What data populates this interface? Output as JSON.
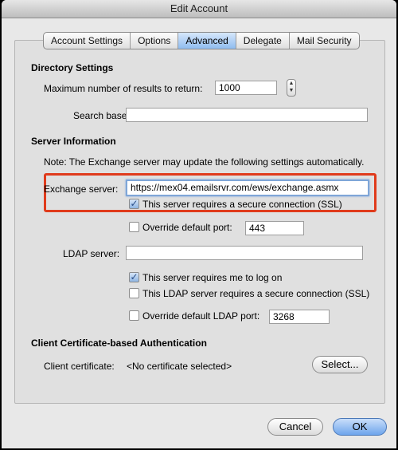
{
  "window": {
    "title": "Edit Account"
  },
  "tabs": [
    {
      "label": "Account Settings"
    },
    {
      "label": "Options"
    },
    {
      "label": "Advanced"
    },
    {
      "label": "Delegate"
    },
    {
      "label": "Mail Security"
    }
  ],
  "directory": {
    "heading": "Directory Settings",
    "max_results_label": "Maximum number of results to return:",
    "max_results_value": "1000",
    "search_base_label": "Search base:",
    "search_base_value": ""
  },
  "server": {
    "heading": "Server Information",
    "note": "Note: The Exchange server may update the following settings automatically.",
    "exchange_label": "Exchange server:",
    "exchange_value": "https://mex04.emailsrvr.com/ews/exchange.asmx",
    "ssl_label": "This server requires a secure connection (SSL)",
    "ssl_checked": true,
    "override_port_label": "Override default port:",
    "override_port_checked": false,
    "port_value": "443",
    "ldap_label": "LDAP server:",
    "ldap_value": "",
    "logon_label": "This server requires me to log on",
    "logon_checked": true,
    "ldap_ssl_label": "This LDAP server requires a secure connection (SSL)",
    "ldap_ssl_checked": false,
    "override_ldap_port_label": "Override default LDAP port:",
    "override_ldap_port_checked": false,
    "ldap_port_value": "3268"
  },
  "certificate": {
    "heading": "Client Certificate-based Authentication",
    "label": "Client certificate:",
    "value": "<No certificate selected>",
    "select_button": "Select..."
  },
  "footer": {
    "cancel_button": "Cancel",
    "ok_button": "OK"
  },
  "colors": {
    "highlight_border": "#e03b1c",
    "default_button": "#6ea5ec"
  }
}
